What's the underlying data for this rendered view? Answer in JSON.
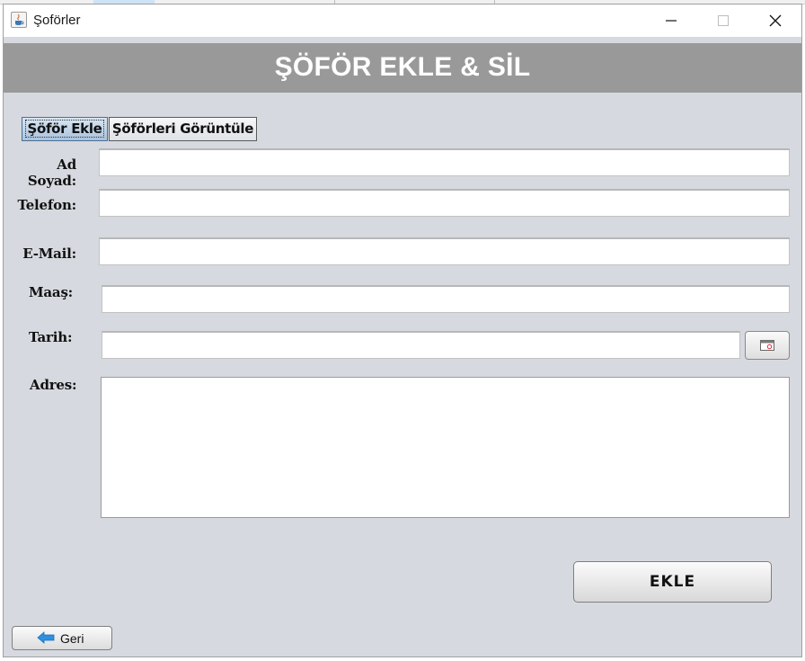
{
  "window": {
    "title": "Şoförler",
    "icons": {
      "app": "java-cup-icon",
      "minimize": "minimize-icon",
      "maximize": "maximize-icon",
      "close": "close-icon"
    }
  },
  "header": {
    "title": "ŞÖFÖR EKLE & SİL",
    "background": "#999999"
  },
  "tabs": [
    {
      "label": "Şöför Ekle",
      "selected": true
    },
    {
      "label": "Şöförleri Görüntüle",
      "selected": false
    }
  ],
  "form": {
    "ad_soyad": {
      "label": "Ad Soyad:",
      "value": ""
    },
    "telefon": {
      "label": "Telefon:",
      "value": ""
    },
    "email": {
      "label": "E-Mail:",
      "value": ""
    },
    "maas": {
      "label": "Maaş:",
      "value": ""
    },
    "tarih": {
      "label": "Tarih:",
      "value": "",
      "picker_icon": "calendar-icon"
    },
    "adres": {
      "label": "Adres:",
      "value": ""
    }
  },
  "buttons": {
    "ekle": "EKLE",
    "geri": "Geri",
    "geri_icon": "back-arrow-icon"
  },
  "colors": {
    "panel": "#d6d9df",
    "tab_active": "#a9c2dd",
    "arrow": "#2f8fe0"
  }
}
